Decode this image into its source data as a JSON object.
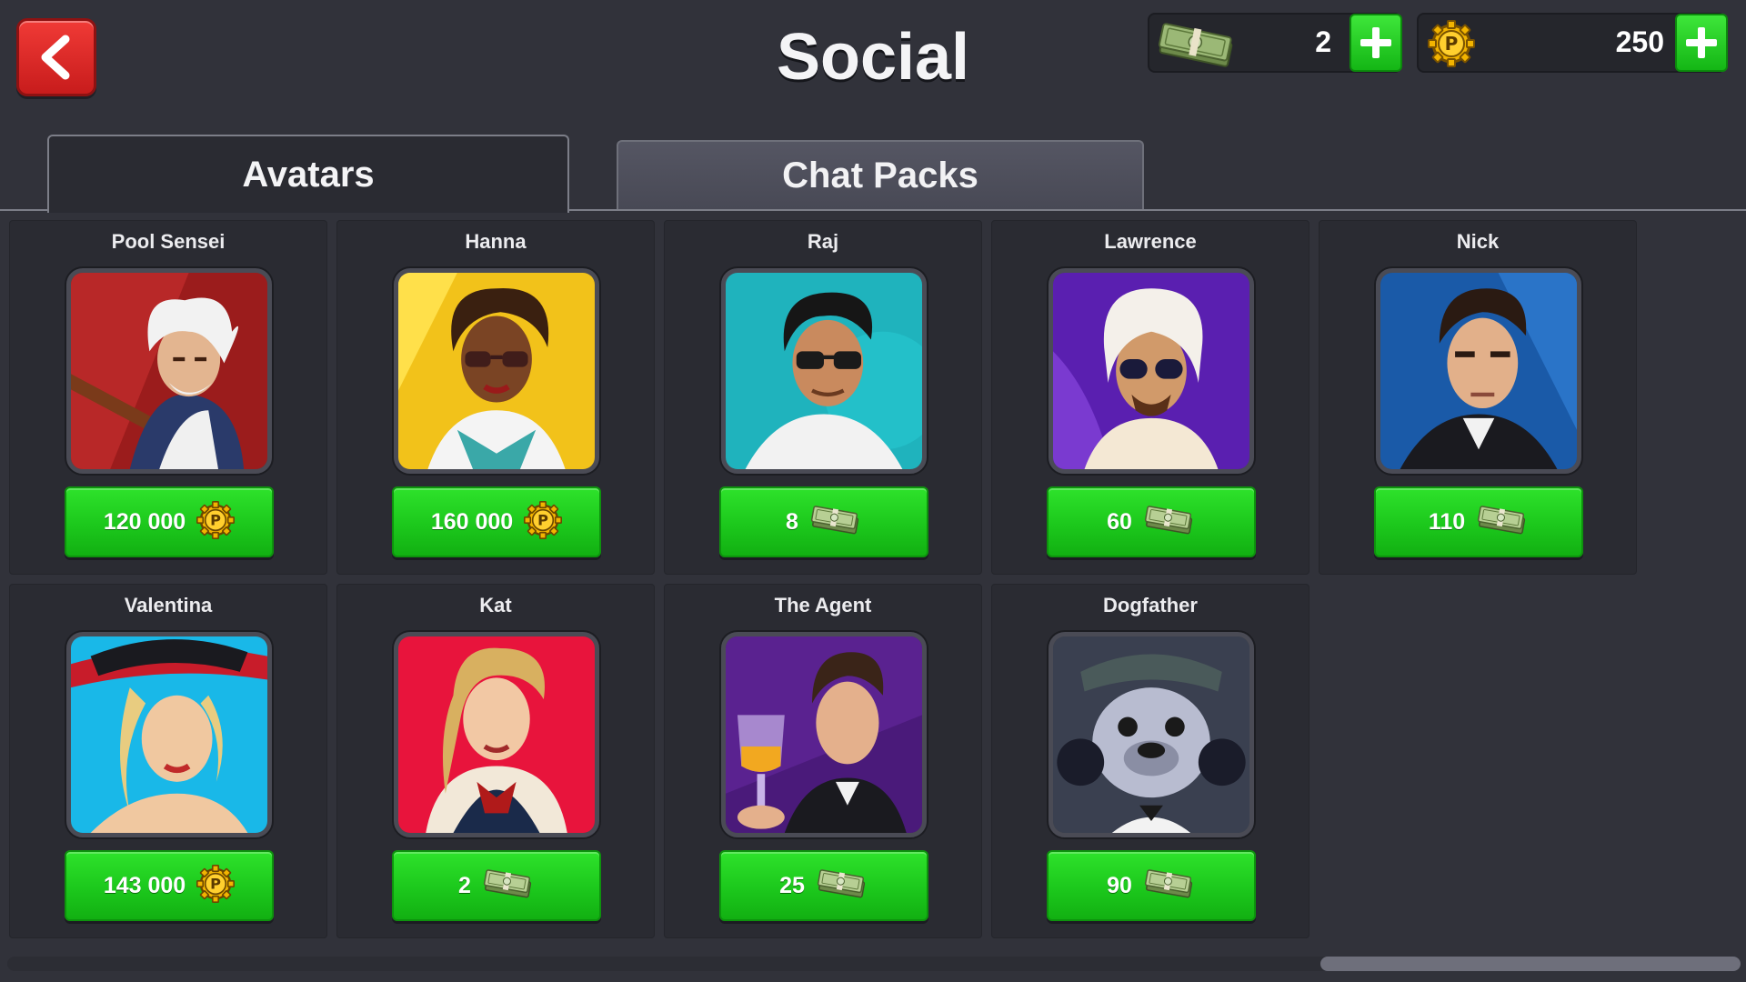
{
  "header": {
    "title": "Social",
    "cash_amount": "2",
    "coins_amount": "250"
  },
  "tabs": [
    {
      "label": "Avatars",
      "active": true
    },
    {
      "label": "Chat Packs",
      "active": false
    }
  ],
  "avatars": [
    {
      "name": "Pool Sensei",
      "price": "120 000",
      "currency_icon": "coin-icon"
    },
    {
      "name": "Hanna",
      "price": "160 000",
      "currency_icon": "coin-icon"
    },
    {
      "name": "Raj",
      "price": "8",
      "currency_icon": "cash-icon"
    },
    {
      "name": "Lawrence",
      "price": "60",
      "currency_icon": "cash-icon"
    },
    {
      "name": "Nick",
      "price": "110",
      "currency_icon": "cash-icon"
    },
    {
      "name": "Valentina",
      "price": "143 000",
      "currency_icon": "coin-icon"
    },
    {
      "name": "Kat",
      "price": "2",
      "currency_icon": "cash-icon"
    },
    {
      "name": "The Agent",
      "price": "25",
      "currency_icon": "cash-icon"
    },
    {
      "name": "Dogfather",
      "price": "90",
      "currency_icon": "cash-icon"
    }
  ],
  "colors": {
    "background": "#31323a",
    "button_green": "#1cc81c",
    "back_red": "#e02a28",
    "coin_gold": "#f2b400"
  }
}
